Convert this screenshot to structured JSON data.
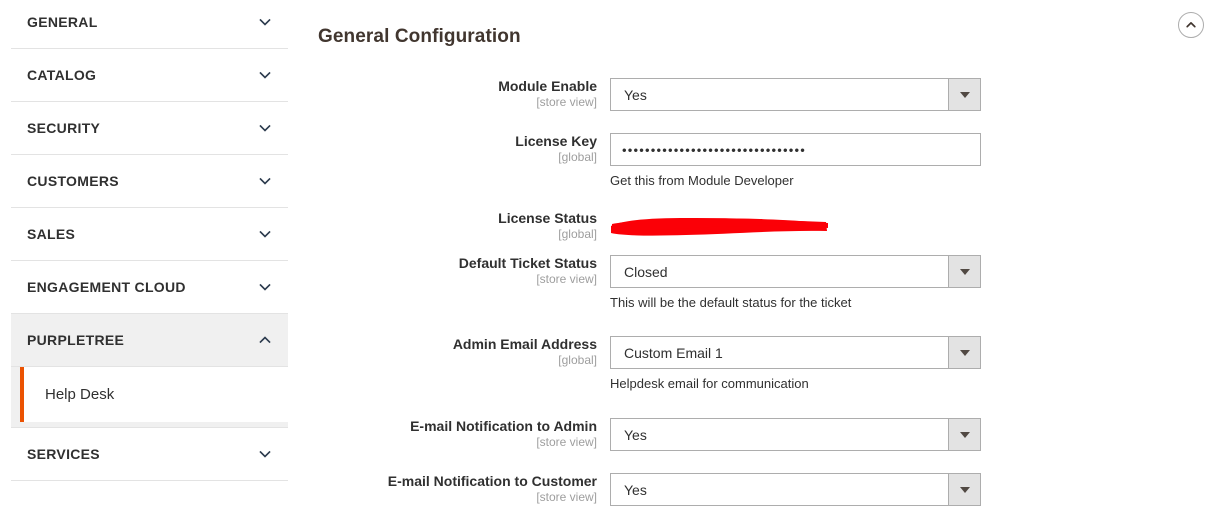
{
  "sidebar": {
    "sections": [
      {
        "label": "GENERAL",
        "icon": "chevron-down-icon",
        "expanded": false
      },
      {
        "label": "CATALOG",
        "icon": "chevron-down-icon",
        "expanded": false
      },
      {
        "label": "SECURITY",
        "icon": "chevron-down-icon",
        "expanded": false
      },
      {
        "label": "CUSTOMERS",
        "icon": "chevron-down-icon",
        "expanded": false
      },
      {
        "label": "SALES",
        "icon": "chevron-down-icon",
        "expanded": false
      },
      {
        "label": "ENGAGEMENT CLOUD",
        "icon": "chevron-down-icon",
        "expanded": false
      },
      {
        "label": "PURPLETREE",
        "icon": "chevron-up-icon",
        "expanded": true
      },
      {
        "label": "SERVICES",
        "icon": "chevron-down-icon",
        "expanded": false
      }
    ],
    "active_child": {
      "label": "Help Desk",
      "accent_color": "#eb5202"
    }
  },
  "header": {
    "title": "General Configuration",
    "collapse_icon": "chevron-up-circle-icon"
  },
  "form": {
    "fields": [
      {
        "label": "Module Enable",
        "scope": "[store view]",
        "type": "select",
        "value": "Yes",
        "note": ""
      },
      {
        "label": "License Key",
        "scope": "[global]",
        "type": "password",
        "value": "••••••••••••••••••••••••••••••••",
        "note": "Get this from Module Developer"
      },
      {
        "label": "License Status",
        "scope": "[global]",
        "type": "redaction",
        "value": "",
        "note": "",
        "redaction_color": "#fb0007"
      },
      {
        "label": "Default Ticket Status",
        "scope": "[store view]",
        "type": "select",
        "value": "Closed",
        "note": "This will be the default status for the ticket"
      },
      {
        "label": "Admin Email Address",
        "scope": "[global]",
        "type": "select",
        "value": "Custom Email 1",
        "note": "Helpdesk email for communication"
      },
      {
        "label": "E-mail Notification to Admin",
        "scope": "[store view]",
        "type": "select",
        "value": "Yes",
        "note": ""
      },
      {
        "label": "E-mail Notification to Customer",
        "scope": "[store view]",
        "type": "select",
        "value": "Yes",
        "note": ""
      }
    ]
  }
}
